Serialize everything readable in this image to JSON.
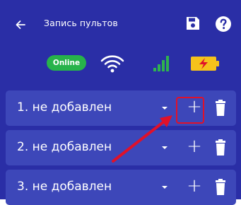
{
  "header": {
    "title": "Запись пультов",
    "back_icon": "arrow-left-icon",
    "save_icon": "floppy-disk-icon",
    "help_icon": "question-circle-icon"
  },
  "status": {
    "online_label": "Online",
    "online_color": "#27b34a",
    "wifi_icon": "wifi-icon",
    "signal_icon": "cellular-signal-icon",
    "battery_icon": "battery-charging-icon"
  },
  "remotes": [
    {
      "label": "1. не добавлен"
    },
    {
      "label": "2. не добавлен"
    },
    {
      "label": "3. не добавлен"
    }
  ],
  "colors": {
    "background": "#2a2ea6",
    "row": "#3d47b9",
    "highlight": "#e0112a",
    "battery": "#f5c21b"
  }
}
